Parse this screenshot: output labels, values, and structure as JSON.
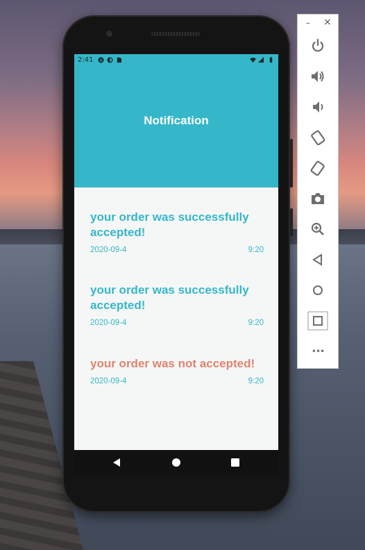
{
  "status_bar": {
    "time": "2:41"
  },
  "header": {
    "title": "Notification",
    "color": "#35b7c9"
  },
  "notifications": [
    {
      "message": "your order was successfully accepted!",
      "date": "2020-09-4",
      "time": "9:20",
      "status": "accepted",
      "color": "#35b7c9"
    },
    {
      "message": "your order was successfully accepted!",
      "date": "2020-09-4",
      "time": "9:20",
      "status": "accepted",
      "color": "#35b7c9"
    },
    {
      "message": "your order was not accepted!",
      "date": "2020-09-4",
      "time": "9:20",
      "status": "rejected",
      "color": "#e0836e"
    }
  ],
  "nav_bar": {
    "icons": [
      "back-triangle-icon",
      "home-circle-icon",
      "recents-square-icon"
    ]
  },
  "toolbar": {
    "window_controls": [
      "minimize-icon",
      "close-icon"
    ],
    "icons": [
      "power-icon",
      "volume-up-icon",
      "volume-down-icon",
      "rotate-left-icon",
      "rotate-right-icon",
      "camera-icon",
      "zoom-icon",
      "back-icon",
      "home-icon",
      "overview-icon",
      "more-icon"
    ],
    "minimize_glyph": "–",
    "close_glyph": "×",
    "more_glyph": "•••"
  }
}
